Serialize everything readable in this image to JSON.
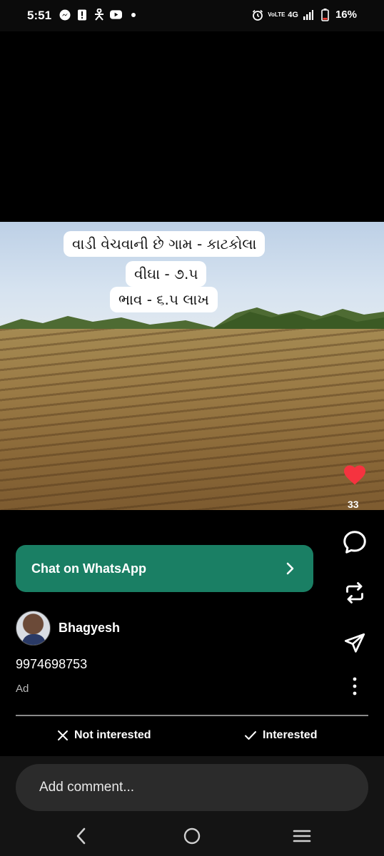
{
  "status_bar": {
    "time": "5:51",
    "left_icons": [
      "messenger-icon",
      "alert-icon",
      "accessibility-icon",
      "youtube-icon",
      "dot-icon"
    ],
    "volte_label_top": "VoLTE",
    "network": "4G",
    "battery": "16%"
  },
  "media": {
    "caption_lines": [
      "વાડી વેચવાની છે ગામ - કાટકોલા",
      "વીઘા - ૭.૫",
      "ભાવ - ૬.૫ લાખ"
    ]
  },
  "actions": {
    "like_count": "33",
    "like_color": "#f5333f"
  },
  "cta": {
    "label": "Chat on WhatsApp",
    "color": "#1a7f64"
  },
  "post": {
    "username": "Bhagyesh",
    "body": "9974698753",
    "ad_label": "Ad"
  },
  "feedback": {
    "not_interested": "Not interested",
    "interested": "Interested"
  },
  "comment": {
    "placeholder": "Add comment..."
  },
  "nav": [
    "back-icon",
    "home-icon",
    "recents-icon"
  ]
}
